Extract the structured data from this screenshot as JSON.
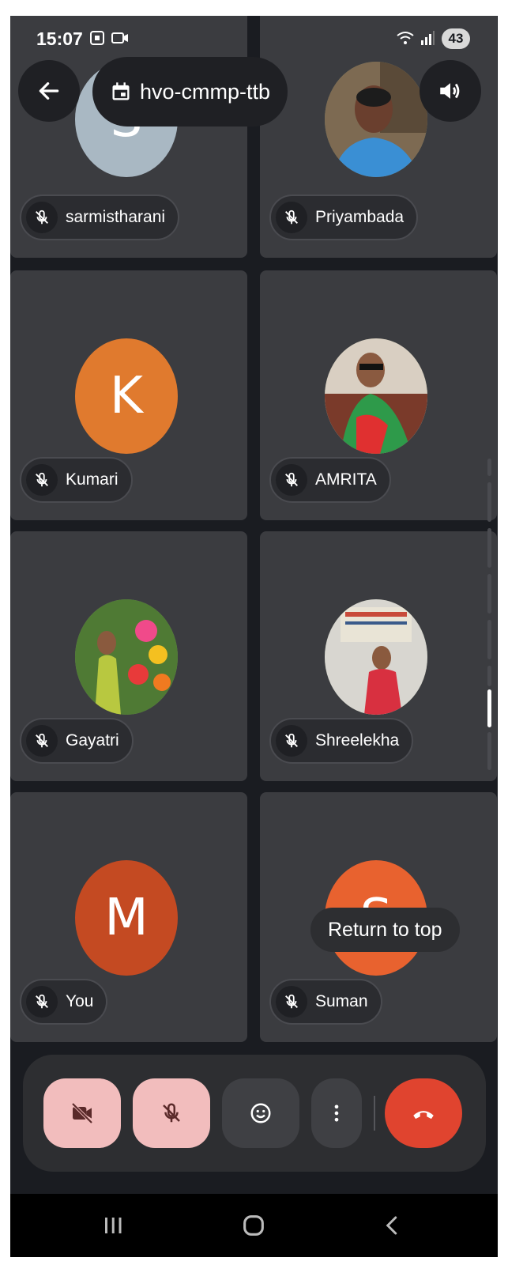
{
  "status_bar": {
    "time": "15:07",
    "battery": "43"
  },
  "header": {
    "back_icon": "arrow-left-icon",
    "meeting_code": "hvo-cmmp-ttb",
    "speaker_icon": "volume-icon"
  },
  "participants": [
    {
      "name": "sarmistharani",
      "avatar_letter": "S",
      "avatar_color": "#a9b8c3",
      "type": "letter"
    },
    {
      "name": "Priyambada",
      "avatar_letter": "",
      "avatar_color": "#6b5a45",
      "type": "photo"
    },
    {
      "name": "Kumari",
      "avatar_letter": "K",
      "avatar_color": "#e07a2e",
      "type": "letter"
    },
    {
      "name": "AMRITA",
      "avatar_letter": "",
      "avatar_color": "#7a4a3a",
      "type": "photo"
    },
    {
      "name": "Gayatri",
      "avatar_letter": "",
      "avatar_color": "#5f8a3e",
      "type": "photo"
    },
    {
      "name": "Shreelekha",
      "avatar_letter": "",
      "avatar_color": "#c8c8c4",
      "type": "photo"
    },
    {
      "name": "You",
      "avatar_letter": "M",
      "avatar_color": "#c44a22",
      "type": "letter"
    },
    {
      "name": "Suman",
      "avatar_letter": "S",
      "avatar_color": "#e8622f",
      "type": "letter"
    }
  ],
  "toast": "Return to top",
  "controls": {
    "camera": "camera-off-icon",
    "mic": "mic-off-icon",
    "reactions": "emoji-icon",
    "more": "more-vert-icon",
    "end_call": "hang-up-icon",
    "accent_off": "#f2bdbd",
    "end_color": "#e0442f"
  }
}
